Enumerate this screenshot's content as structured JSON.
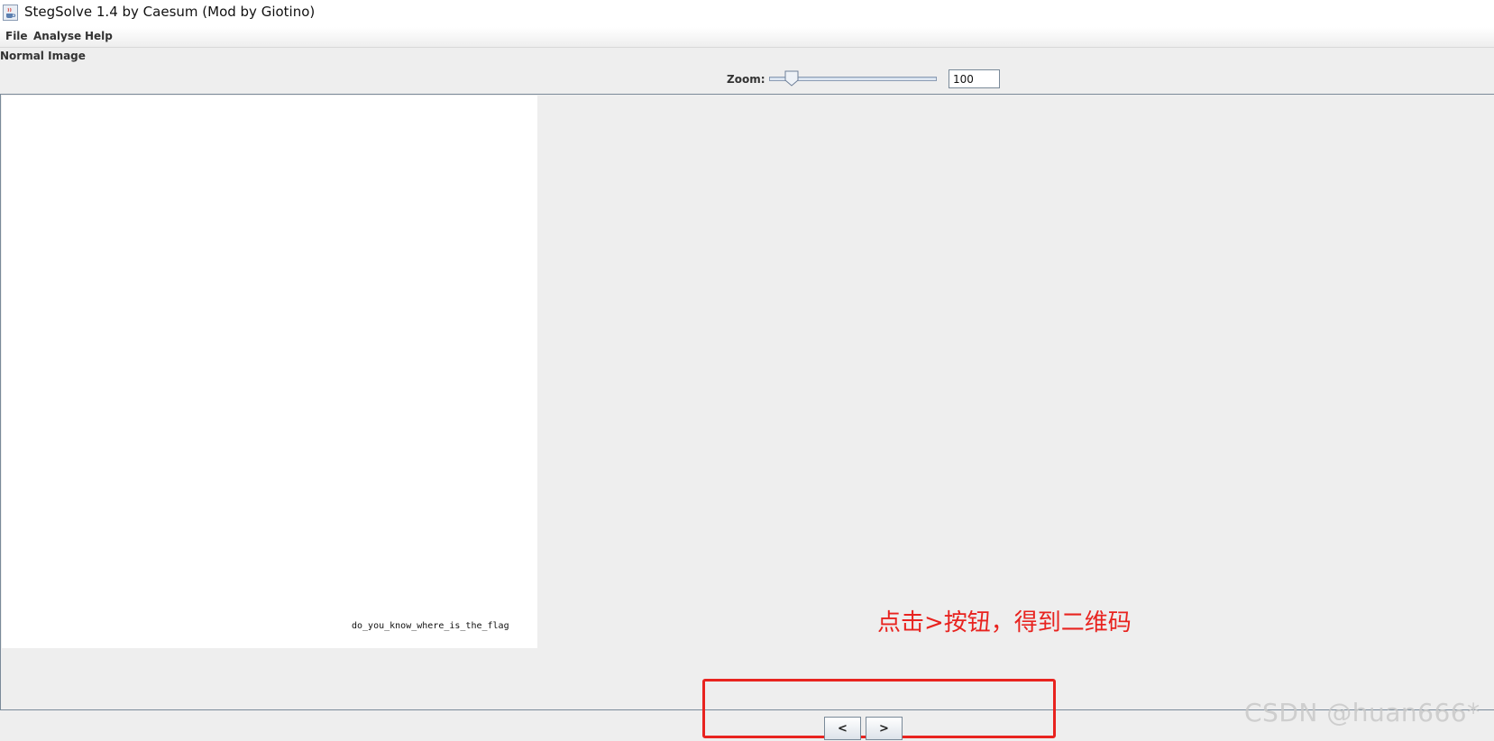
{
  "window": {
    "title": "StegSolve 1.4 by Caesum (Mod by Giotino)",
    "app_icon": "java-cup-icon"
  },
  "menu": {
    "items": [
      {
        "label": "File"
      },
      {
        "label": "Analyse"
      },
      {
        "label": "Help"
      }
    ]
  },
  "view": {
    "mode_label": "Normal Image",
    "zoom_label": "Zoom:",
    "zoom_value": "100",
    "zoom_level_fraction": 0.1
  },
  "image": {
    "caption": "do_you_know_where_is_the_flag"
  },
  "annotation": {
    "text": "点击>按钮，得到二维码",
    "color": "#e8231f"
  },
  "navigation": {
    "prev_label": "<",
    "next_label": ">"
  },
  "watermark": {
    "text": "CSDN @huan666*"
  }
}
